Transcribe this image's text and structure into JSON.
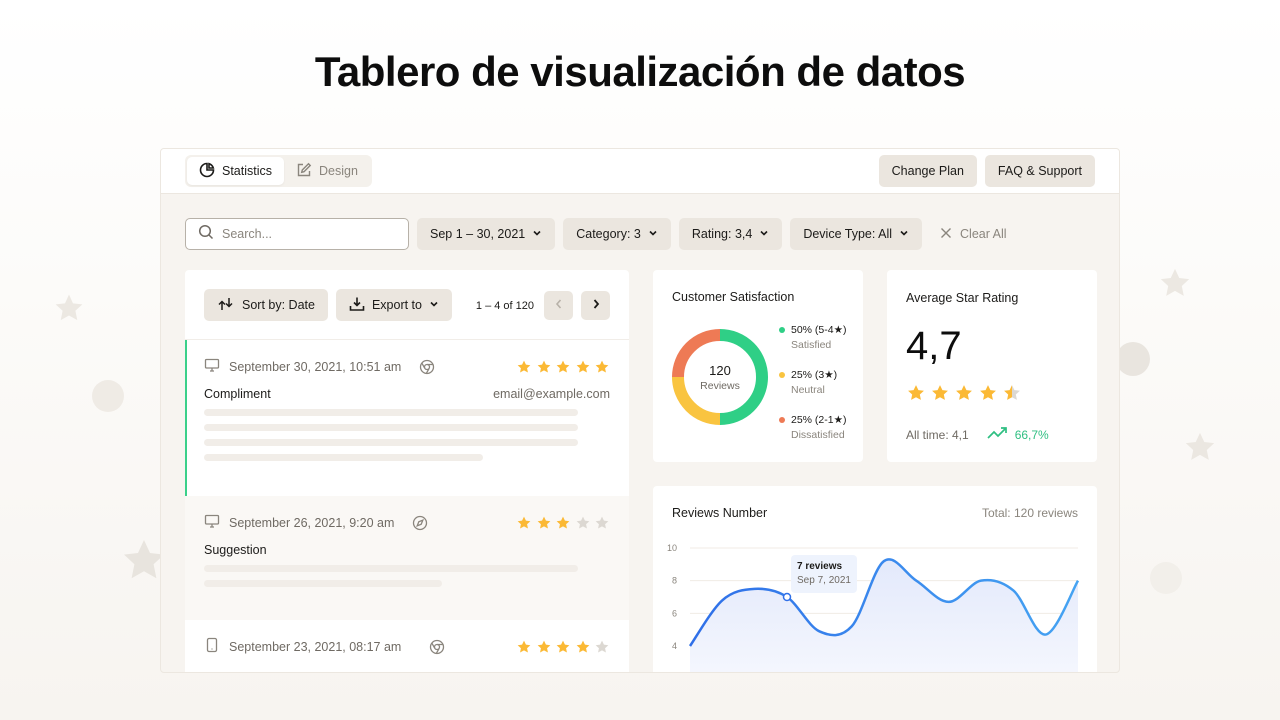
{
  "page": {
    "title": "Tablero de visualización de datos"
  },
  "topbar": {
    "tabs": [
      {
        "label": "Statistics",
        "icon": "pie-chart-icon",
        "active": true
      },
      {
        "label": "Design",
        "icon": "edit-icon",
        "active": false
      }
    ],
    "actions": [
      {
        "label": "Change Plan"
      },
      {
        "label": "FAQ & Support"
      }
    ]
  },
  "filters": {
    "search_placeholder": "Search...",
    "search_value": "",
    "date_range": "Sep 1 –  30, 2021",
    "category": "Category: 3",
    "rating": "Rating: 3,4",
    "device_type": "Device Type: All",
    "clear_all": "Clear All"
  },
  "reviews_toolbar": {
    "sort_label": "Sort by: Date",
    "export_label": "Export to",
    "pagination": "1 – 4 of 120"
  },
  "reviews": [
    {
      "device": "desktop",
      "date": "September 30, 2021, 10:51 am",
      "browser": "chrome",
      "rating": 5,
      "category": "Compliment",
      "email": "email@example.com",
      "selected": true
    },
    {
      "device": "desktop",
      "date": "September 26, 2021, 9:20 am",
      "browser": "safari",
      "rating": 3,
      "category": "Suggestion",
      "email": "",
      "selected": false
    },
    {
      "device": "mobile",
      "date": "September 23, 2021, 08:17 am",
      "browser": "chrome",
      "rating": 4,
      "category": "",
      "email": "",
      "selected": false
    }
  ],
  "satisfaction": {
    "title": "Customer Satisfaction",
    "total": "120",
    "total_label": "Reviews",
    "segments": [
      {
        "label": "50% (5-4★)",
        "sub": "Satisfied",
        "percent": 50,
        "color": "#2fcf86"
      },
      {
        "label": "25% (3★)",
        "sub": "Neutral",
        "percent": 25,
        "color": "#f9c440"
      },
      {
        "label": "25% (2-1★)",
        "sub": "Dissatisfied",
        "percent": 25,
        "color": "#ee7a55"
      }
    ]
  },
  "average_rating": {
    "title": "Average Star Rating",
    "value": "4,7",
    "stars": 4.5,
    "all_time": "All time: 4,1",
    "trend": "66,7%"
  },
  "colors": {
    "accent_green": "#2fbf82",
    "star": "#fbb935",
    "star_empty": "#dcd8d2",
    "line": "#3b82f6"
  },
  "chart_data": {
    "type": "line",
    "title": "Reviews Number",
    "subtitle": "Total: 120 reviews",
    "xlabel": "",
    "ylabel": "",
    "ylim": [
      3,
      10
    ],
    "yticks": [
      10,
      8,
      6,
      4
    ],
    "grid": true,
    "x": [
      0,
      1,
      2,
      3,
      4,
      5,
      6,
      7,
      8,
      9,
      10,
      11,
      12
    ],
    "series": [
      {
        "name": "Reviews",
        "values": [
          4,
          6.8,
          7.5,
          7.0,
          4.9,
          5.2,
          9.2,
          8.0,
          6.7,
          8.0,
          7.4,
          4.7,
          8.0
        ]
      }
    ],
    "tooltip": {
      "value": "7 reviews",
      "date": "Sep  7, 2021",
      "index": 3
    }
  }
}
